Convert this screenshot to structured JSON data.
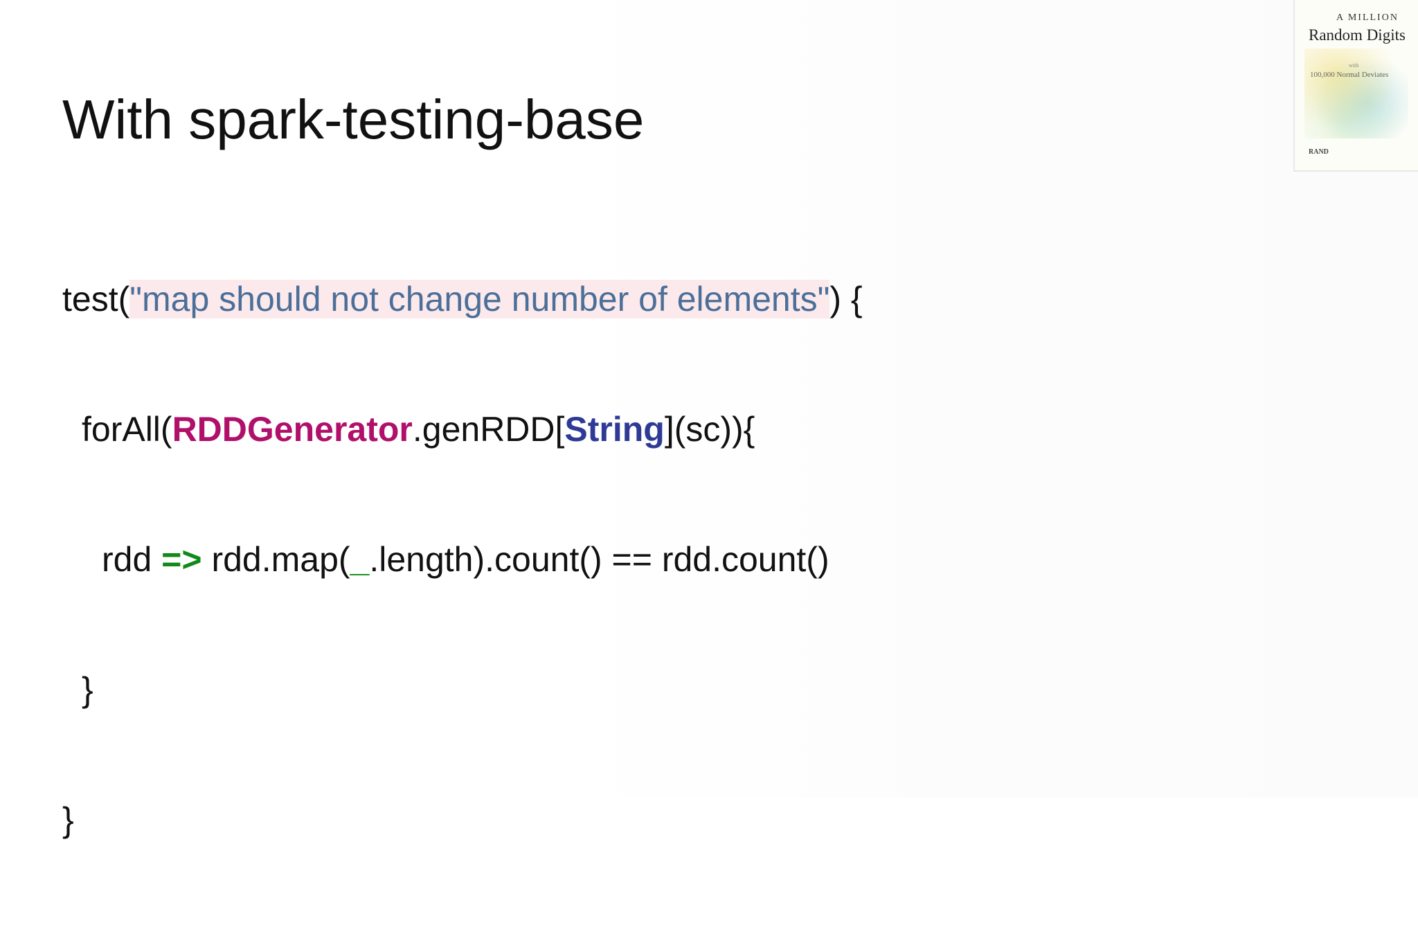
{
  "slide": {
    "title": "With spark-testing-base",
    "code": {
      "line1": {
        "prefix": "test(",
        "string": "\"map should not change number of elements\"",
        "suffix": ") {"
      },
      "line2": {
        "prefix": "forAll(",
        "generator": "RDDGenerator",
        "middle": ".genRDD[",
        "type": "String",
        "suffix": "](sc)){"
      },
      "line3": {
        "prefix": "rdd ",
        "arrow": "=>",
        "middle": " rdd.map(",
        "underscore": "_",
        "suffix": ".length).count() == rdd.count()"
      },
      "line4": "}",
      "line5": "}"
    }
  },
  "book_cover": {
    "top_line": "A MILLION",
    "title": "Random Digits",
    "small": "with",
    "subtitle": "100,000 Normal Deviates",
    "publisher": "RAND"
  }
}
